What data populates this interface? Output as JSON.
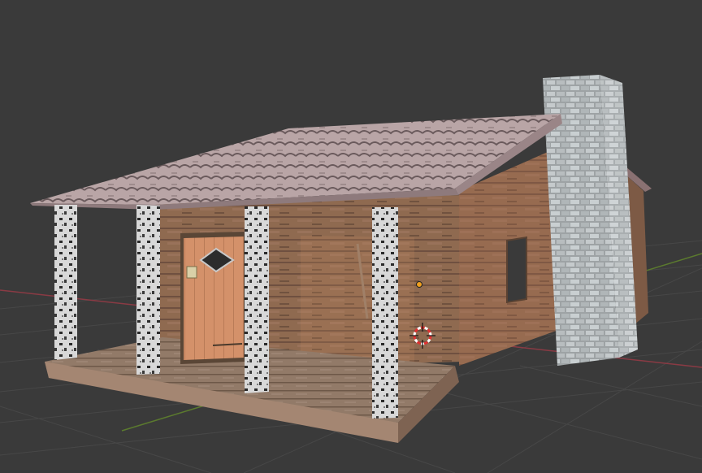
{
  "viewport": {
    "background_color": "#3a3a3a",
    "grid_line_color": "#474747",
    "axis_x_color": "#8a3a44",
    "axis_y_color": "#5b7a2e"
  },
  "scene": {
    "object": "log cabin",
    "materials": {
      "roof": "#b9a5a6",
      "roof_shadow": "#6a5a5c",
      "wood_wall": "#8f6a50",
      "wood_wall_dark": "#6f5040",
      "floor": "#927a68",
      "door": "#d4916a",
      "chimney_stone": "#b5bbbd",
      "birch_post": "#d8d8d8"
    },
    "overlays": {
      "origin_marker_icon": "origin-dot-icon",
      "cursor_3d_icon": "3d-cursor-icon",
      "origin_color": "#f0a020",
      "cursor_color": "#e03030"
    }
  }
}
